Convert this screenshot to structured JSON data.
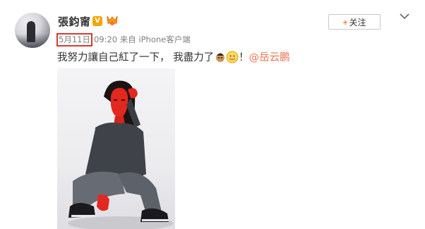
{
  "post": {
    "username": "張鈞甯",
    "verified_badge": "V",
    "date": "5月11日",
    "time_source": "09:20 来自 iPhone客户端",
    "content_text": "我努力讓自己紅了一下， 我盡力了",
    "content_suffix": "！",
    "mention": "@岳云鹏"
  },
  "actions": {
    "follow_plus": "+",
    "follow_label": "关注"
  },
  "icons": {
    "follow": "plus-icon",
    "menu": "chevron-down-icon",
    "badge": "verified-v-icon",
    "bigv": "gold-medal-icon"
  },
  "colors": {
    "accent": "#eb7350",
    "date_highlight": "#d63b2f",
    "badge": "#f6a500",
    "photo_tint": "#e8241c"
  }
}
